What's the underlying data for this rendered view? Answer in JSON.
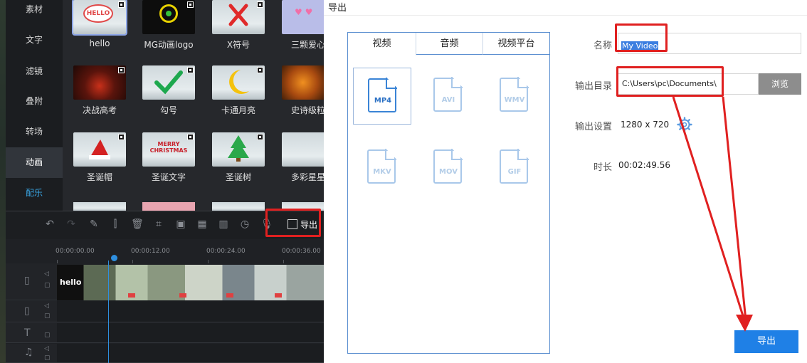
{
  "editor": {
    "nav": [
      "素材",
      "文字",
      "滤镜",
      "叠附",
      "转场",
      "动画",
      "配乐"
    ],
    "effects": [
      {
        "label": "hello",
        "thumb_text": "HELLO"
      },
      {
        "label": "MG动画logo"
      },
      {
        "label": "X符号"
      },
      {
        "label": "三颗爱心"
      },
      {
        "label": "决战高考"
      },
      {
        "label": "勾号"
      },
      {
        "label": "卡通月亮"
      },
      {
        "label": "史诗级粒"
      },
      {
        "label": "圣诞帽"
      },
      {
        "label": "圣诞文字",
        "thumb_text": "MERRY CHRISTMAS"
      },
      {
        "label": "圣诞树"
      },
      {
        "label": "多彩星星"
      }
    ],
    "toolbar": {
      "export_label": "导出"
    },
    "ruler": [
      "00:00:00.00",
      "00:00:12.00",
      "00:00:24.00",
      "00:00:36.00"
    ],
    "clip_label": "hello"
  },
  "dialog": {
    "title": "导出",
    "tabs": [
      "视频",
      "音频",
      "视频平台"
    ],
    "formats": [
      "MP4",
      "AVI",
      "WMV",
      "MKV",
      "MOV",
      "GIF"
    ],
    "fields": {
      "name_label": "名称",
      "name_value": "My Video",
      "dir_label": "输出目录",
      "dir_value": "C:\\Users\\pc\\Documents\\",
      "browse_label": "浏览",
      "settings_label": "输出设置",
      "settings_value": "1280 x 720",
      "duration_label": "时长",
      "duration_value": "00:02:49.56"
    },
    "export_label": "导出"
  },
  "colors": {
    "accent": "#1f80e6",
    "highlight": "#e02020",
    "music": "#3aa7e6"
  }
}
